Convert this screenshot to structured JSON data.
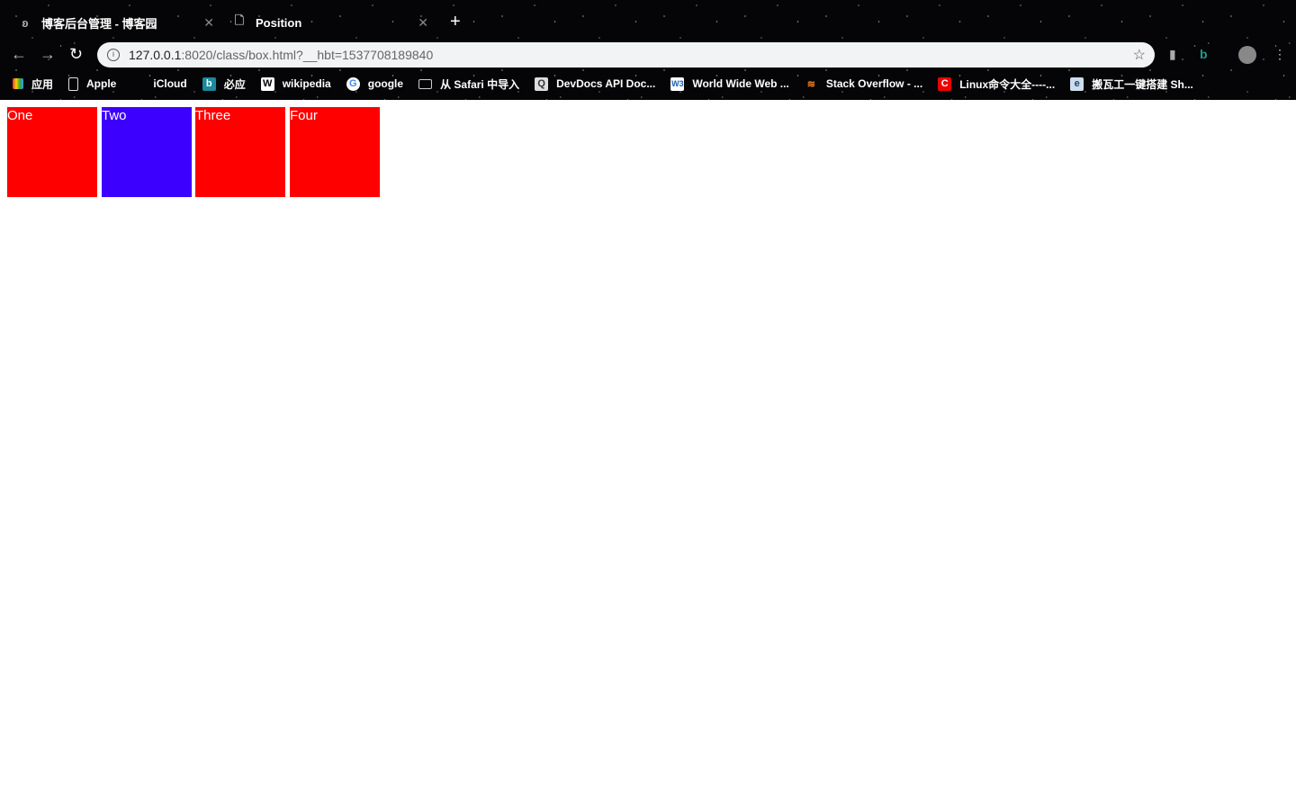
{
  "browser": {
    "tabs": [
      {
        "title": "博客后台管理 - 博客园",
        "icon": "blog-icon",
        "active": false
      },
      {
        "title": "Position",
        "icon": "page-icon",
        "active": true
      }
    ],
    "address": {
      "host": "127.0.0.1",
      "path": ":8020/class/box.html?__hbt=1537708189840"
    },
    "bookmarks": [
      {
        "label": "应用",
        "icon": "apps-grid-icon"
      },
      {
        "label": "Apple",
        "icon": "page-icon"
      },
      {
        "label": "iCloud",
        "icon": "apple-icon"
      },
      {
        "label": "必应",
        "icon": "bing-icon"
      },
      {
        "label": "wikipedia",
        "icon": "wikipedia-icon"
      },
      {
        "label": "google",
        "icon": "google-icon"
      },
      {
        "label": "从 Safari 中导入",
        "icon": "folder-icon"
      },
      {
        "label": "DevDocs API Doc...",
        "icon": "devdocs-icon"
      },
      {
        "label": "World Wide Web ...",
        "icon": "w3c-icon"
      },
      {
        "label": "Stack Overflow - ...",
        "icon": "stackoverflow-icon"
      },
      {
        "label": "Linux命令大全----...",
        "icon": "linux-icon"
      },
      {
        "label": "搬瓦工一键搭建 Sh...",
        "icon": "site-icon"
      }
    ]
  },
  "page": {
    "boxes": [
      {
        "label": "One",
        "color": "#ff0000"
      },
      {
        "label": "Two",
        "color": "#3c00ff"
      },
      {
        "label": "Three",
        "color": "#ff0000"
      },
      {
        "label": "Four",
        "color": "#ff0000"
      }
    ]
  }
}
